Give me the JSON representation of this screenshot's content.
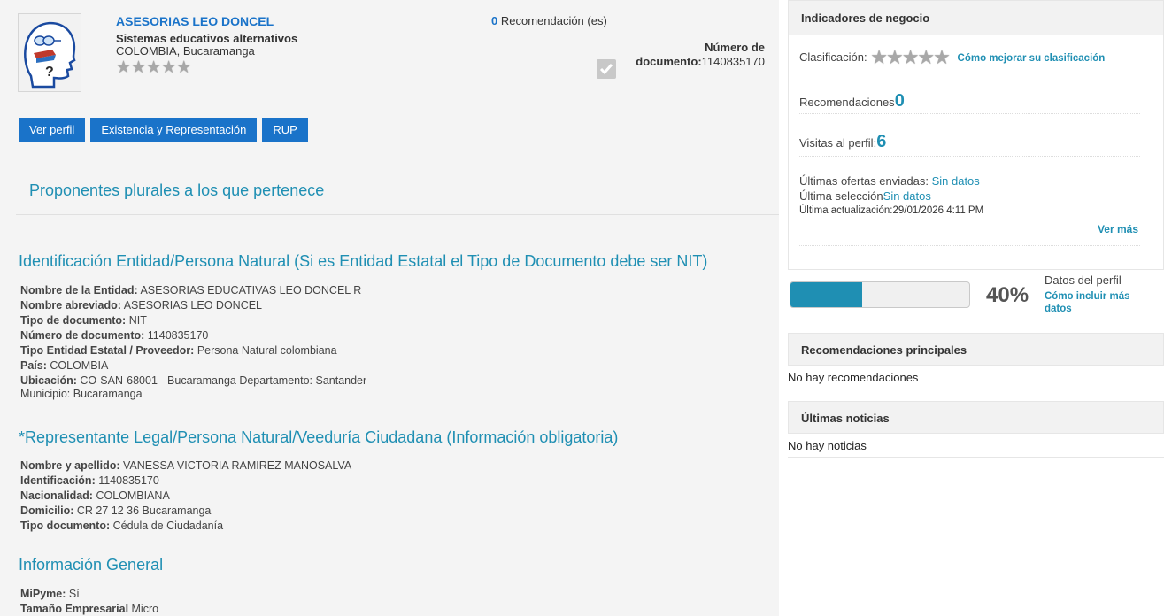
{
  "header": {
    "org_name": "ASESORIAS LEO DONCEL",
    "subtitle": "Sistemas educativos alternativos",
    "location": "COLOMBIA, Bucaramanga",
    "rating_stars": 0,
    "recommendation_count": "0",
    "recommendation_label": " Recomendación (es)",
    "doc_label_line1": "Número de",
    "doc_label_bold": "documento:",
    "doc_number": "1140835170"
  },
  "tabs": [
    {
      "label": "Ver perfil"
    },
    {
      "label": "Existencia y Representación"
    },
    {
      "label": "RUP"
    }
  ],
  "plural_title": "Proponentes plurales a los que pertenece",
  "identificacion": {
    "title": "Identificación Entidad/Persona Natural (Si es Entidad Estatal el Tipo de Documento debe ser NIT)",
    "rows": [
      {
        "label": "Nombre de la Entidad:",
        "value": " ASESORIAS EDUCATIVAS LEO DONCEL R"
      },
      {
        "label": "Nombre abreviado:",
        "value": " ASESORIAS LEO DONCEL"
      },
      {
        "label": "Tipo de documento:",
        "value": " NIT"
      },
      {
        "label": "Número de documento:",
        "value": " 1140835170"
      },
      {
        "label": "Tipo Entidad Estatal / Proveedor:",
        "value": " Persona Natural colombiana"
      },
      {
        "label": "País:",
        "value": " COLOMBIA"
      },
      {
        "label": "Ubicación:",
        "value": " CO-SAN-68001 - Bucaramanga Departamento: Santander"
      },
      {
        "label": "",
        "value": "Municipio: Bucaramanga"
      }
    ]
  },
  "representante": {
    "title": "*Representante Legal/Persona Natural/Veeduría Ciudadana (Información obligatoria)",
    "rows": [
      {
        "label": "Nombre y apellido:",
        "value": " VANESSA VICTORIA RAMIREZ MANOSALVA"
      },
      {
        "label": "Identificación:",
        "value": " 1140835170"
      },
      {
        "label": "Nacionalidad:",
        "value": " COLOMBIANA"
      },
      {
        "label": "Domicilio:",
        "value": " CR 27 12 36 Bucaramanga"
      },
      {
        "label": "Tipo documento:",
        "value": " Cédula de Ciudadanía"
      }
    ]
  },
  "general": {
    "title": "Información General",
    "rows": [
      {
        "label": "MiPyme:",
        "value": " Sí"
      },
      {
        "label": "Tamaño Empresarial",
        "value": " Micro"
      }
    ]
  },
  "sidebar": {
    "indicators_title": "Indicadores de negocio",
    "clasificacion_label": "Clasificación:",
    "clasificacion_link": "Cómo mejorar su clasificación",
    "recomendaciones_label": "Recomendaciones",
    "recomendaciones_value": "0",
    "visitas_label": "Visitas al perfil:",
    "visitas_value": "6",
    "ultimas_ofertas_label": "Últimas ofertas enviadas: ",
    "ultimas_ofertas_value": "Sin datos",
    "ultima_seleccion_label": "Última selección",
    "ultima_seleccion_value": "Sin datos",
    "ultima_actualizacion": "Última actualización:29/01/2026 4:11 PM",
    "ver_mas": "Ver más",
    "profile_percent": 40,
    "profile_percent_label": "40%",
    "datos_perfil_label": "Datos del perfil",
    "datos_perfil_link": "Cómo incluir más datos",
    "rec_principales_title": "Recomendaciones principales",
    "rec_principales_content": "No hay recomendaciones",
    "noticias_title": "Últimas noticias",
    "noticias_content": "No hay noticias"
  },
  "colors": {
    "link_blue": "#1a73c9",
    "teal": "#1f8fb3",
    "tab_bg": "#1a73c9"
  }
}
